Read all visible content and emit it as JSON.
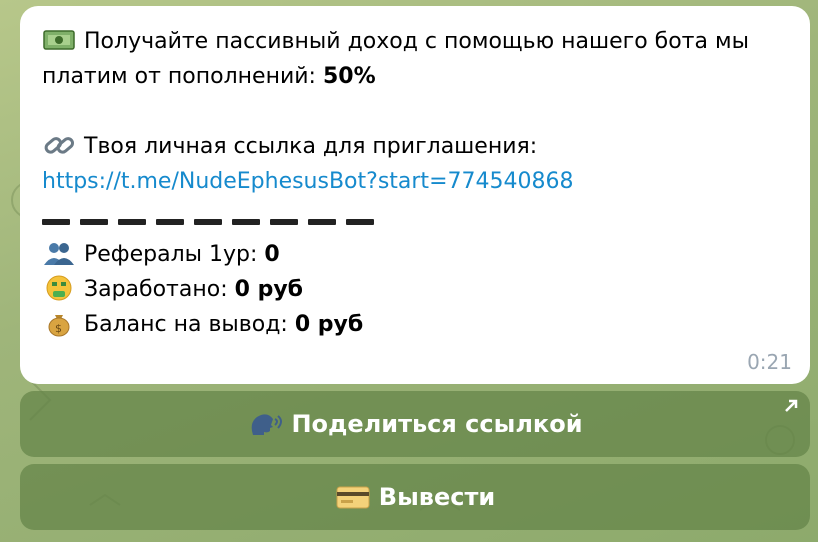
{
  "message": {
    "line1": "Получайте пассивный доход с помощью нашего бота мы",
    "line2_text": "платим от пополнений: ",
    "line2_bold": "50%",
    "invite_label": "Твоя личная ссылка для приглашения:",
    "invite_link": "https://t.me/NudeEphesusBot?start=774540868",
    "stats": [
      {
        "label": "Рефералы 1ур: ",
        "value": "0"
      },
      {
        "label": "Заработано: ",
        "value": "0 руб"
      },
      {
        "label": "Баланс на вывод: ",
        "value": "0 руб"
      }
    ],
    "time": "0:21"
  },
  "buttons": {
    "share": "Поделиться ссылкой",
    "withdraw": "Вывести"
  },
  "icons": [
    "money-icon",
    "link-icon",
    "users-icon",
    "money-mouth-face-icon",
    "money-bag-icon",
    "speech-head-icon",
    "credit-card-icon",
    "external-arrow-icon"
  ]
}
